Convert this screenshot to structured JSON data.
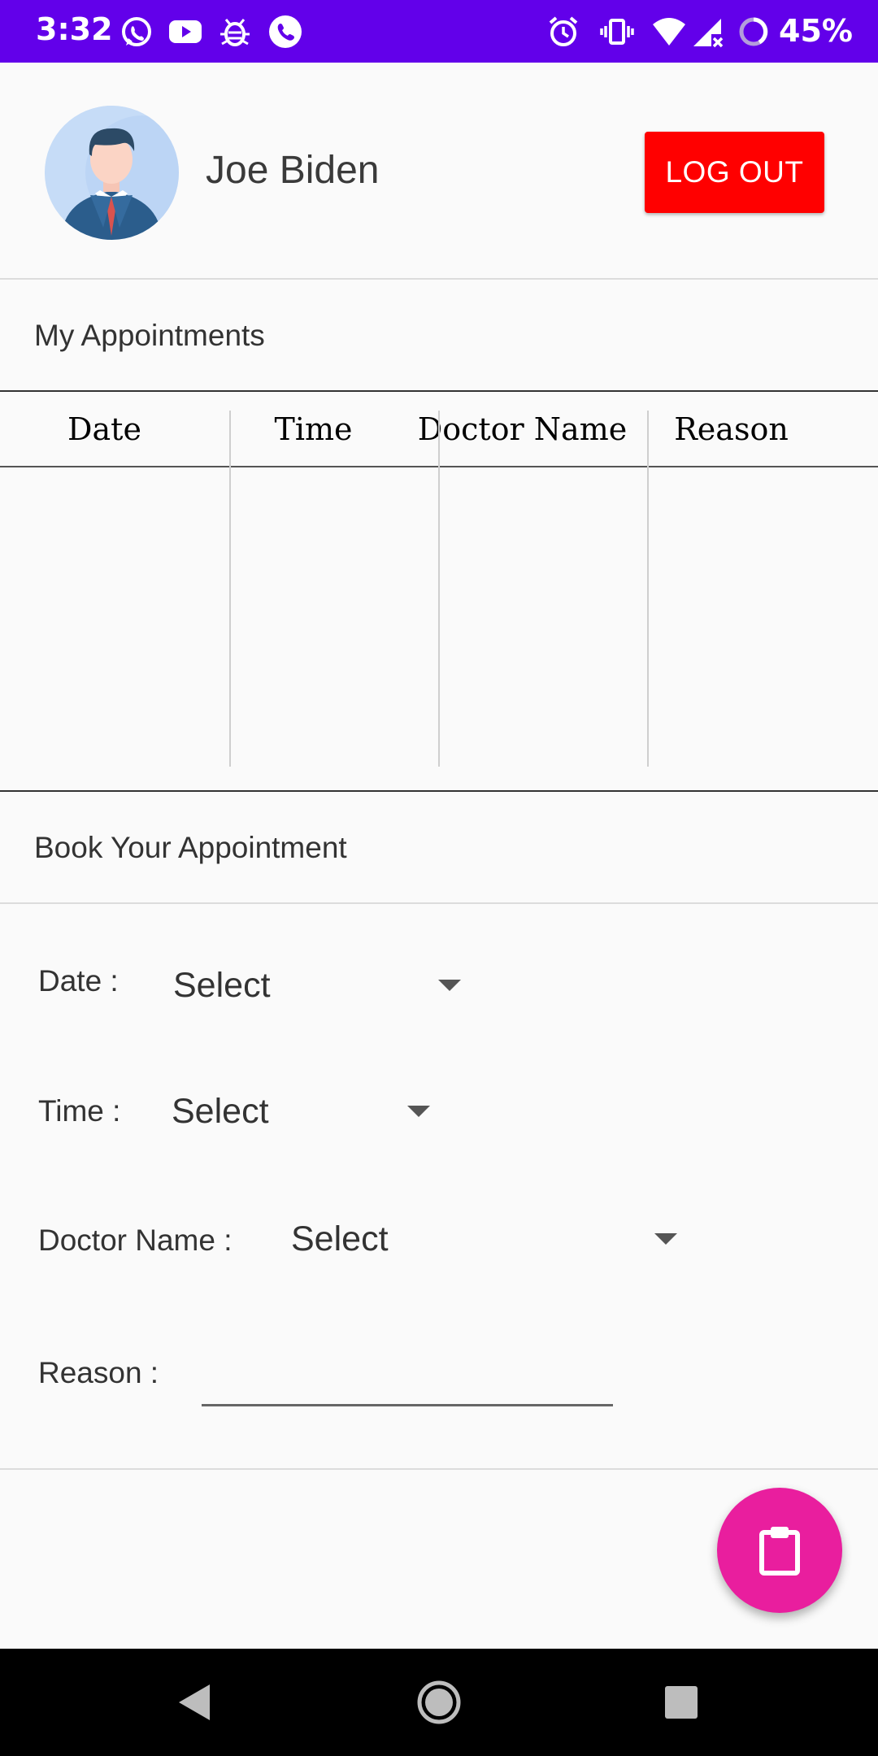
{
  "status_bar": {
    "time": "3:32",
    "battery_percent": "45%",
    "left_icons": [
      "whatsapp-icon",
      "youtube-icon",
      "bug-icon",
      "phone-icon"
    ],
    "right_icons": [
      "alarm-icon",
      "vibrate-icon",
      "wifi-icon",
      "signal-icon",
      "battery-icon"
    ],
    "background": "#6200ea"
  },
  "profile": {
    "name": "Joe Biden",
    "logout_label": "LOG OUT",
    "logout_color": "#ff0000"
  },
  "appointments": {
    "title": "My Appointments",
    "columns": [
      "Date",
      "Time",
      "Doctor Name",
      "Reason"
    ],
    "rows": []
  },
  "booking": {
    "title": "Book Your Appointment",
    "date_label": "Date :",
    "date_value": "Select",
    "time_label": "Time :",
    "time_value": "Select",
    "doctor_label": "Doctor Name :",
    "doctor_value": "Select",
    "reason_label": "Reason :",
    "reason_value": ""
  },
  "fab": {
    "icon": "clipboard-icon",
    "color": "#e91e9e"
  },
  "nav_bar": {
    "buttons": [
      "back-icon",
      "home-icon",
      "recents-icon"
    ]
  }
}
